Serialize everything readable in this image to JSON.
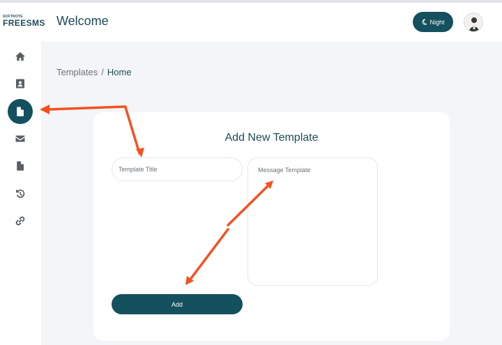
{
  "brand": {
    "small": "SOFTROTE",
    "name": "FREESMS"
  },
  "header": {
    "title": "Welcome",
    "night_label": "Night",
    "night_icon": "moon-icon"
  },
  "sidebar": {
    "items": [
      {
        "name": "home",
        "icon": "home-icon"
      },
      {
        "name": "contacts",
        "icon": "contact-book-icon"
      },
      {
        "name": "templates",
        "icon": "file-icon",
        "active": true
      },
      {
        "name": "messages",
        "icon": "envelope-icon"
      },
      {
        "name": "documents",
        "icon": "document-icon"
      },
      {
        "name": "history",
        "icon": "history-icon"
      },
      {
        "name": "links",
        "icon": "link-icon"
      }
    ]
  },
  "breadcrumb": {
    "parent": "Templates",
    "separator": "/",
    "current": "Home"
  },
  "form": {
    "title": "Add New Template",
    "template_title_placeholder": "Template Title",
    "message_placeholder": "Message Template",
    "add_label": "Add"
  },
  "colors": {
    "primary": "#14505d",
    "annotation": "#f4511e",
    "background": "#f4f5f8"
  }
}
